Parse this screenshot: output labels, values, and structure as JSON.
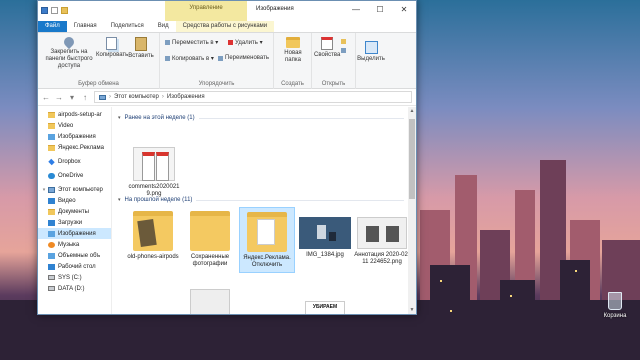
{
  "window": {
    "title": "Изображения",
    "context_tab_header": "Управление",
    "controls": {
      "minimize": "—",
      "maximize": "☐",
      "close": "✕"
    }
  },
  "ribbon_tabs": [
    "Файл",
    "Главная",
    "Поделиться",
    "Вид",
    "Средства работы с рисунками"
  ],
  "ribbon": {
    "clipboard": {
      "pin": "Закрепить на панели быстрого доступа",
      "copy": "Копировать",
      "paste": "Вставить",
      "label": "Буфер обмена"
    },
    "organize": {
      "move": "Переместить в ▾",
      "copy_to": "Копировать в ▾",
      "delete": "Удалить ▾",
      "rename": "Переименовать",
      "label": "Упорядочить"
    },
    "new": {
      "new_folder": "Новая папка",
      "label": "Создать"
    },
    "open": {
      "properties": "Свойства",
      "label": "Открыть"
    },
    "select": {
      "select": "Выделить"
    }
  },
  "address": {
    "back": "←",
    "forward": "→",
    "recent": "▾",
    "up": "↑",
    "crumbs": [
      "Этот компьютер",
      "Изображения"
    ]
  },
  "nav_pane": [
    "airpods-setup-ar",
    "Video",
    "Изображения",
    "Яндекс.Реклама",
    "Dropbox",
    "OneDrive",
    "Этот компьютер",
    "Видео",
    "Документы",
    "Загрузки",
    "Изображения",
    "Музыка",
    "Объемные объ",
    "Рабочий стол",
    "SYS (C:)",
    "DATA (D:)"
  ],
  "groups": [
    {
      "header": "Ранее на этой неделе (1)"
    },
    {
      "header": "На прошлой неделе (11)"
    }
  ],
  "files": [
    "comments20200219.png",
    "old-phones-airpods",
    "Сохраненные фотографии",
    "Яндекс.Реклама. Отключить",
    "IMG_1384.jpg",
    "Аннотация 2020-02-11 224652.png"
  ],
  "partial_thumb_text": "УБИРАЕМ",
  "desktop": {
    "recycle_bin": "Корзина"
  }
}
